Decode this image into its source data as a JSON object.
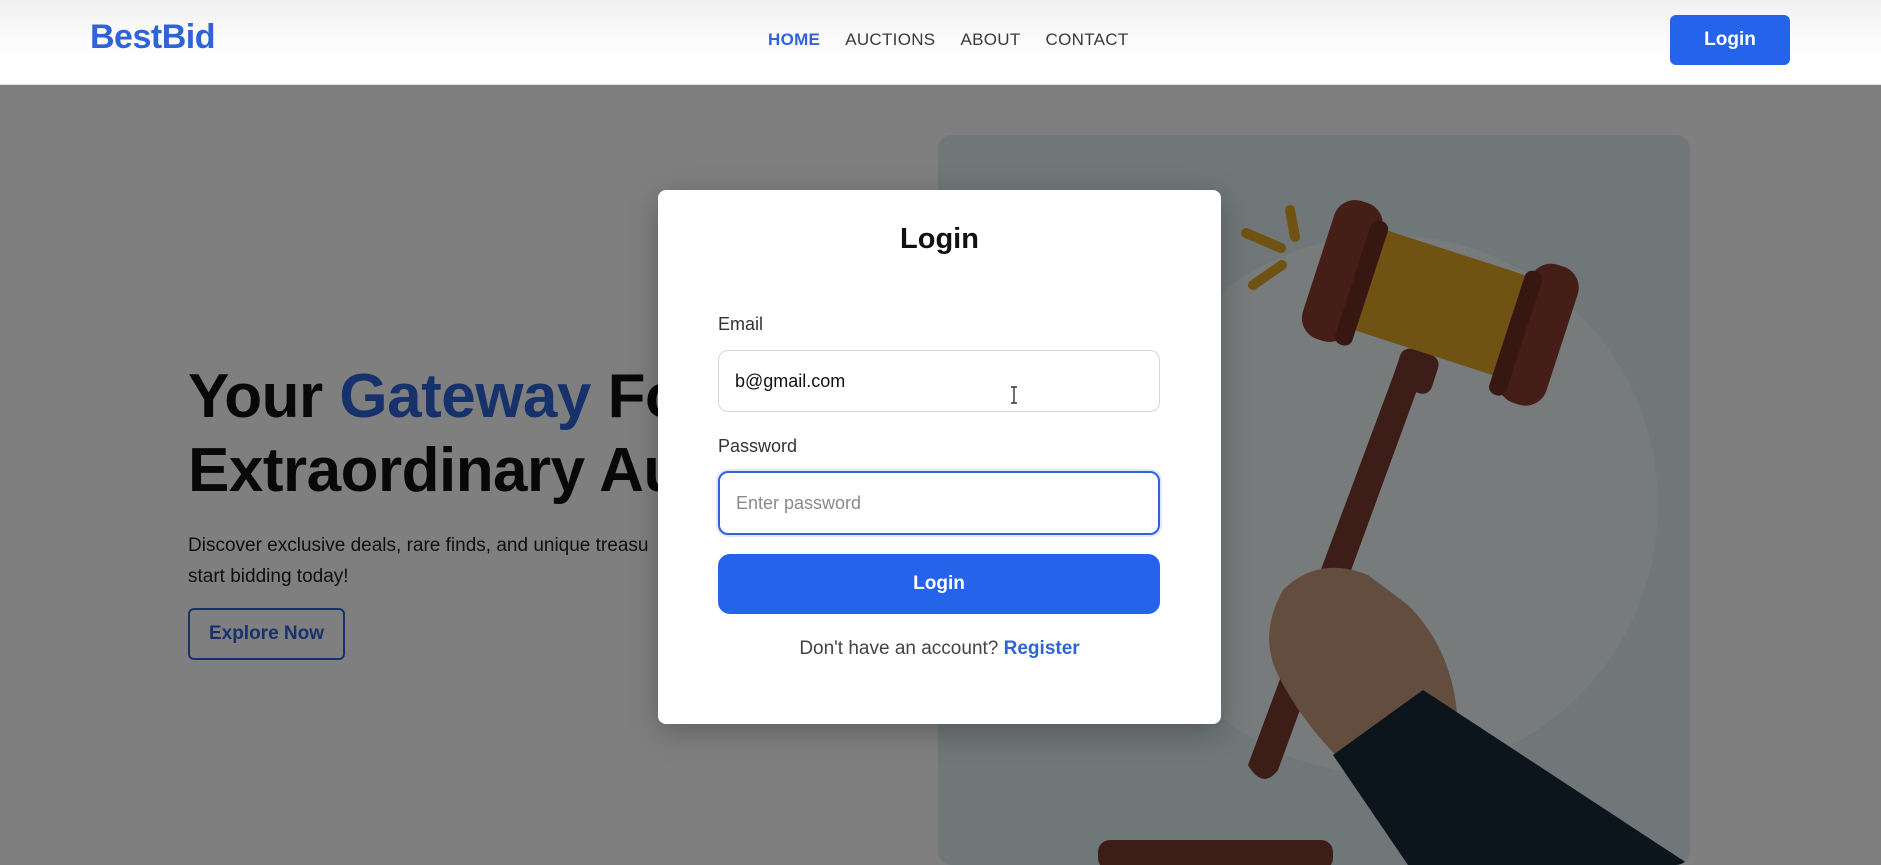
{
  "navbar": {
    "logo": "BestBid",
    "links": [
      {
        "label": "HOME",
        "active": true
      },
      {
        "label": "AUCTIONS",
        "active": false
      },
      {
        "label": "ABOUT",
        "active": false
      },
      {
        "label": "CONTACT",
        "active": false
      }
    ],
    "login_label": "Login"
  },
  "hero": {
    "title_line1_prefix": "Your ",
    "title_line1_accent": "Gateway",
    "title_line1_suffix": " For",
    "title_line2": "Extraordinary Au",
    "description_line1": "Discover exclusive deals, rare finds, and unique treasu",
    "description_line2": "start bidding today!",
    "cta_label": "Explore Now",
    "image_icon": "gavel-icon"
  },
  "modal": {
    "title": "Login",
    "email_label": "Email",
    "email_value": "b@gmail.com",
    "password_label": "Password",
    "password_placeholder": "Enter password",
    "submit_label": "Login",
    "register_prompt": "Don't have an account? ",
    "register_link": "Register"
  },
  "colors": {
    "brand": "#2f63d6",
    "button": "#2563eb",
    "overlay": "rgba(0,0,0,0.5)"
  }
}
